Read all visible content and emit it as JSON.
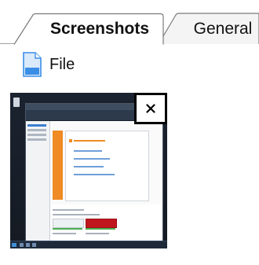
{
  "tabs": [
    {
      "label": "Screenshots",
      "active": true
    },
    {
      "label": "General",
      "active": false
    }
  ],
  "file_item": {
    "label": "File",
    "icon": "document-icon"
  },
  "thumbnail": {
    "close_icon": "close-icon",
    "close_symbol": "×"
  },
  "colors": {
    "tab_border": "#7a7a7a",
    "accent_orange": "#f08a24",
    "accent_red": "#c0161e",
    "file_icon_blue": "#3a8ee6"
  }
}
